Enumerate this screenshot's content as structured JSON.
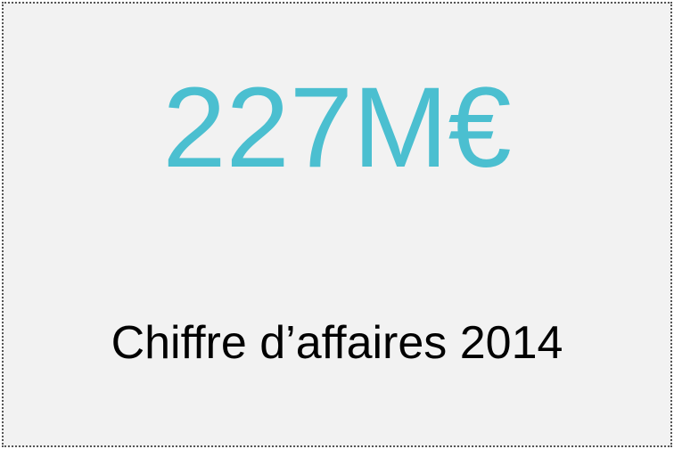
{
  "kpi": {
    "value": "227M€",
    "label": "Chiffre d’affaires 2014",
    "value_color": "#4bbfd0",
    "label_color": "#000000",
    "background_color": "#f2f2f2"
  }
}
